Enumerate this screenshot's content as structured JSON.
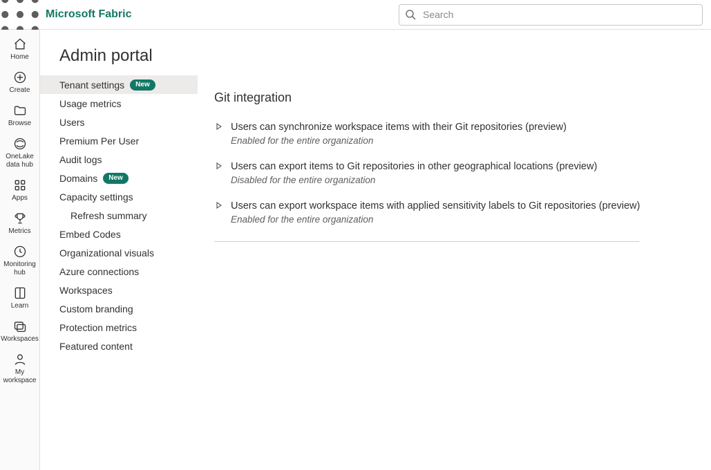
{
  "header": {
    "brand": "Microsoft Fabric",
    "search_placeholder": "Search"
  },
  "rail": {
    "items": [
      {
        "label": "Home"
      },
      {
        "label": "Create"
      },
      {
        "label": "Browse"
      },
      {
        "label": "OneLake data hub"
      },
      {
        "label": "Apps"
      },
      {
        "label": "Metrics"
      },
      {
        "label": "Monitoring hub"
      },
      {
        "label": "Learn"
      },
      {
        "label": "Workspaces"
      },
      {
        "label": "My workspace"
      }
    ]
  },
  "page": {
    "title": "Admin portal"
  },
  "admin_nav": {
    "items": [
      {
        "label": "Tenant settings",
        "badge": "New"
      },
      {
        "label": "Usage metrics"
      },
      {
        "label": "Users"
      },
      {
        "label": "Premium Per User"
      },
      {
        "label": "Audit logs"
      },
      {
        "label": "Domains",
        "badge": "New"
      },
      {
        "label": "Capacity settings"
      },
      {
        "label": "Refresh summary"
      },
      {
        "label": "Embed Codes"
      },
      {
        "label": "Organizational visuals"
      },
      {
        "label": "Azure connections"
      },
      {
        "label": "Workspaces"
      },
      {
        "label": "Custom branding"
      },
      {
        "label": "Protection metrics"
      },
      {
        "label": "Featured content"
      }
    ]
  },
  "section": {
    "title": "Git integration",
    "settings": [
      {
        "title": "Users can synchronize workspace items with their Git repositories (preview)",
        "status": "Enabled for the entire organization"
      },
      {
        "title": "Users can export items to Git repositories in other geographical locations (preview)",
        "status": "Disabled for the entire organization"
      },
      {
        "title": "Users can export workspace items with applied sensitivity labels to Git repositories (preview)",
        "status": "Enabled for the entire organization"
      }
    ]
  }
}
